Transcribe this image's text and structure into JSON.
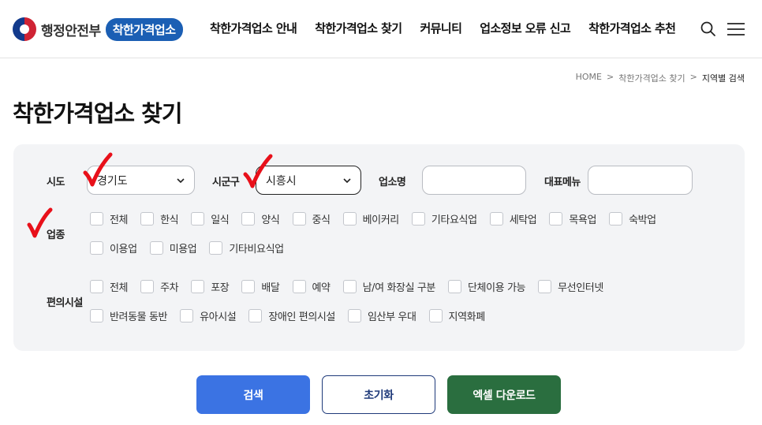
{
  "header": {
    "ministry_name": "행정안전부",
    "brand_label": "착한가격업소",
    "nav": [
      {
        "label": "착한가격업소 안내"
      },
      {
        "label": "착한가격업소 찾기"
      },
      {
        "label": "커뮤니티"
      },
      {
        "label": "업소정보 오류 신고"
      },
      {
        "label": "착한가격업소 추천"
      }
    ],
    "icons": {
      "search": "search-icon",
      "menu": "hamburger-menu-icon"
    }
  },
  "breadcrumb": {
    "home": "HOME",
    "sep": ">",
    "parent": "착한가격업소 찾기",
    "current": "지역별 검색"
  },
  "page_title": "착한가격업소 찾기",
  "filters": {
    "sido_label": "시도",
    "sido_value": "경기도",
    "sigungu_label": "시군구",
    "sigungu_value": "시흥시",
    "store_name_label": "업소명",
    "store_name_value": "",
    "menu_label": "대표메뉴",
    "menu_value": "",
    "category_label": "업종",
    "categories_row1": [
      "전체",
      "한식",
      "일식",
      "양식",
      "중식",
      "베이커리",
      "기타요식업",
      "세탁업",
      "목욕업",
      "숙박업"
    ],
    "categories_row2": [
      "이용업",
      "미용업",
      "기타비요식업"
    ],
    "facility_label": "편의시설",
    "facilities_row1": [
      "전체",
      "주차",
      "포장",
      "배달",
      "예약",
      "남/여 화장실 구분",
      "단체이용 가능",
      "무선인터넷"
    ],
    "facilities_row2": [
      "반려동물 동반",
      "유아시설",
      "장애인 편의시설",
      "임산부 우대",
      "지역화폐"
    ]
  },
  "actions": {
    "search_label": "검색",
    "reset_label": "초기화",
    "excel_label": "엑셀 다운로드"
  },
  "colors": {
    "brand_blue": "#1b5fb4",
    "search_button": "#3b73e3",
    "reset_border": "#1f3a7a",
    "excel_button": "#2a6e3f",
    "annotation_red": "#e8101a",
    "panel_bg": "#f3f4f6"
  }
}
